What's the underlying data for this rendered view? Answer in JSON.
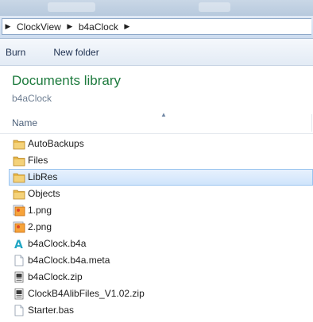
{
  "address_bar": {
    "crumbs": [
      "ClockView",
      "b4aClock"
    ]
  },
  "toolbar": {
    "burn_label": "Burn",
    "new_folder_label": "New folder"
  },
  "library": {
    "title": "Documents library",
    "subtitle": "b4aClock"
  },
  "columns": {
    "name_label": "Name"
  },
  "files": [
    {
      "name": "AutoBackups",
      "icon": "folder-icon"
    },
    {
      "name": "Files",
      "icon": "folder-icon"
    },
    {
      "name": "LibRes",
      "icon": "folder-icon",
      "selected": true
    },
    {
      "name": "Objects",
      "icon": "folder-icon"
    },
    {
      "name": "1.png",
      "icon": "image-file-icon"
    },
    {
      "name": "2.png",
      "icon": "image-file-icon"
    },
    {
      "name": "b4aClock.b4a",
      "icon": "b4a-file-icon"
    },
    {
      "name": "b4aClock.b4a.meta",
      "icon": "generic-file-icon"
    },
    {
      "name": "b4aClock.zip",
      "icon": "zip-file-icon"
    },
    {
      "name": "ClockB4AlibFiles_V1.02.zip",
      "icon": "zip-file-icon"
    },
    {
      "name": "Starter.bas",
      "icon": "generic-file-icon"
    }
  ],
  "colors": {
    "library_title": "#1e7b3e",
    "selection_border": "#9ac4ef",
    "folder": "#e8b84a"
  }
}
